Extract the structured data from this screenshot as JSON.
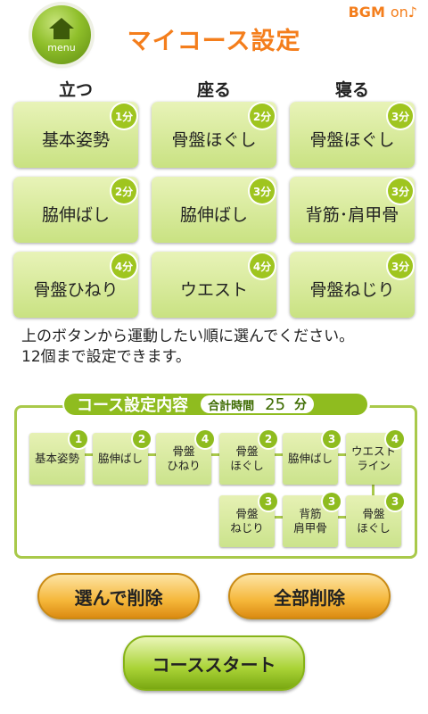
{
  "header": {
    "menu_label": "menu",
    "title": "マイコース設定",
    "bgm_label": "BGM",
    "bgm_state": "on♪"
  },
  "categories": [
    "立つ",
    "座る",
    "寝る"
  ],
  "exercises": [
    {
      "label": "基本姿勢",
      "duration": "1分"
    },
    {
      "label": "骨盤ほぐし",
      "duration": "2分"
    },
    {
      "label": "骨盤ほぐし",
      "duration": "3分"
    },
    {
      "label": "脇伸ばし",
      "duration": "2分"
    },
    {
      "label": "脇伸ばし",
      "duration": "3分"
    },
    {
      "label": "背筋･肩甲骨",
      "duration": "3分"
    },
    {
      "label": "骨盤ひねり",
      "duration": "4分"
    },
    {
      "label": "ウエスト",
      "duration": "4分"
    },
    {
      "label": "骨盤ねじり",
      "duration": "3分"
    }
  ],
  "instructions": [
    "上のボタンから運動したい順に選んでください。",
    "12個まで設定できます。"
  ],
  "course_panel": {
    "title": "コース設定内容",
    "total_label": "合計時間",
    "total_value": "25",
    "total_unit": "分"
  },
  "course_slots": [
    {
      "label": "基本姿勢",
      "minutes": "1"
    },
    {
      "label": "脇伸ばし",
      "minutes": "2"
    },
    {
      "label": "骨盤\nひねり",
      "minutes": "4"
    },
    {
      "label": "骨盤\nほぐし",
      "minutes": "2"
    },
    {
      "label": "脇伸ばし",
      "minutes": "3"
    },
    {
      "label": "ウエスト\nライン",
      "minutes": "4"
    },
    {
      "label": "骨盤\nねじり",
      "minutes": "3"
    },
    {
      "label": "背筋\n肩甲骨",
      "minutes": "3"
    },
    {
      "label": "骨盤\nほぐし",
      "minutes": "3"
    }
  ],
  "buttons": {
    "select_delete": "選んで削除",
    "delete_all": "全部削除",
    "course_start": "コーススタート"
  },
  "colors": {
    "accent_orange": "#f47e1c",
    "accent_green": "#8fbc1f",
    "button_green_light": "#e8f3b8"
  },
  "icons": {
    "menu": "home-house-icon"
  }
}
